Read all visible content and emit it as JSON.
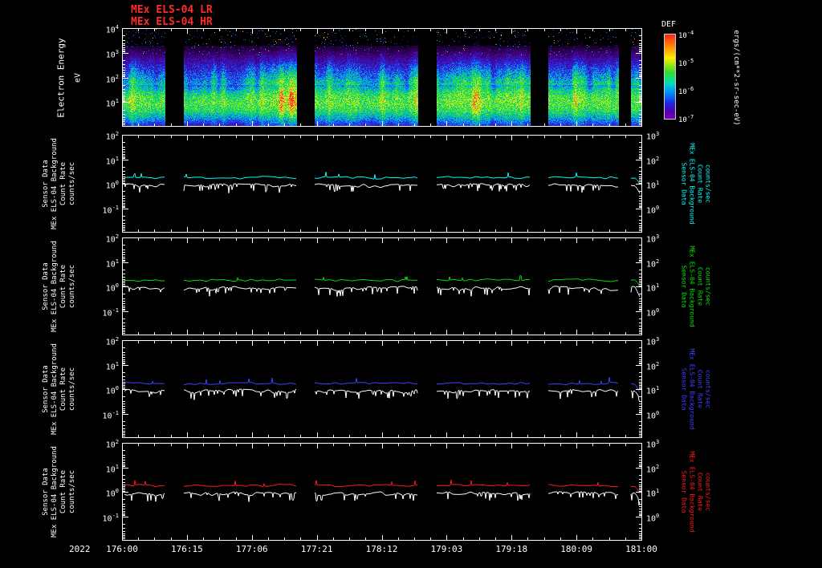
{
  "header": {
    "title_lr": "MEx ELS-04 LR",
    "title_hr": "MEx ELS-04 HR",
    "title_color": "#ff2a2a"
  },
  "x_axis": {
    "year": "2022",
    "tick_labels": [
      "176:00",
      "176:15",
      "177:06",
      "177:21",
      "178:12",
      "179:03",
      "179:18",
      "180:09",
      "181:00"
    ]
  },
  "spectrogram": {
    "ylabel_line1": "Electron Energy",
    "ylabel_line2": "eV",
    "y_ticks": [
      "10^4",
      "10^3",
      "10^2",
      "10^1"
    ],
    "colorbar": {
      "title": "DEF",
      "units": "ergs/(cm**2-sr-sec-eV)",
      "ticks": [
        "10^-4",
        "10^-5",
        "10^-6",
        "10^-7"
      ]
    }
  },
  "panels": [
    {
      "color": "#00ffff",
      "label_lines": [
        "Sensor Data",
        "MEx ELS-04 Background",
        "Count Rate",
        "counts/sec"
      ],
      "left_ticks": [
        "10^2",
        "10^1",
        "10^0",
        "10^-1"
      ],
      "right_ticks": [
        "10^3",
        "10^2",
        "10^1",
        "10^0"
      ]
    },
    {
      "color": "#00e000",
      "label_lines": [
        "Sensor Data",
        "MEx ELS-04 Background",
        "Count Rate",
        "counts/sec"
      ],
      "left_ticks": [
        "10^2",
        "10^1",
        "10^0",
        "10^-1"
      ],
      "right_ticks": [
        "10^3",
        "10^2",
        "10^1",
        "10^0"
      ]
    },
    {
      "color": "#4040ff",
      "label_lines": [
        "Sensor Data",
        "MEx ELS-04 Background",
        "Count Rate",
        "counts/sec"
      ],
      "left_ticks": [
        "10^2",
        "10^1",
        "10^0",
        "10^-1"
      ],
      "right_ticks": [
        "10^3",
        "10^2",
        "10^1",
        "10^0"
      ]
    },
    {
      "color": "#ff1a1a",
      "label_lines": [
        "Sensor Data",
        "MEx ELS-04 Background",
        "Count Rate",
        "counts/sec"
      ],
      "left_ticks": [
        "10^2",
        "10^1",
        "10^0",
        "10^-1"
      ],
      "right_ticks": [
        "10^3",
        "10^2",
        "10^1",
        "10^0"
      ]
    }
  ],
  "chart_data": [
    {
      "type": "heatmap",
      "title": "MEx ELS-04 LR/HR electron energy-time spectrogram",
      "xlabel": "time (day-of-year:hour, 2022)",
      "x_range": [
        "176:00",
        "181:00"
      ],
      "x_tick_labels": [
        "176:00",
        "176:15",
        "177:06",
        "177:21",
        "178:12",
        "179:03",
        "179:18",
        "180:09",
        "181:00"
      ],
      "ylabel": "Electron Energy (eV)",
      "y_log_range": [
        1,
        10000
      ],
      "y_tick_labels": [
        "10^4",
        "10^3",
        "10^2",
        "10^1"
      ],
      "value_label": "DEF ergs/(cm**2-sr-sec-eV)",
      "value_log_range": [
        1e-07,
        0.0001
      ],
      "colorscale": "rainbow (purple low to red high)",
      "legend_position": "right colorbar",
      "features": {
        "bright_band_eV": [
          3,
          150
        ],
        "hotspots": "quasi-periodic yellow/orange/red flares reaching ~300 eV",
        "diffuse_blue_purple_band_eV": [
          150,
          1500
        ],
        "sparse_speckle_above_eV": 1500,
        "data_gaps_frac": [
          [
            0.083,
            0.118
          ],
          [
            0.335,
            0.37
          ],
          [
            0.568,
            0.604
          ],
          [
            0.784,
            0.818
          ],
          [
            0.955,
            0.978
          ]
        ]
      }
    },
    {
      "type": "line",
      "title": "Sensor Data / MEx ELS-04 Background Count Rate (panel 1)",
      "ylabel": "Count Rate counts/sec",
      "ylim_log": [
        0.01,
        100
      ],
      "right_axis_log": [
        0.1,
        1000
      ],
      "x_range": [
        "176:00",
        "181:00"
      ],
      "series": [
        {
          "name": "MEx ELS-04 Background",
          "color": "#00ffff",
          "approx_mean": 1.8
        },
        {
          "name": "Sensor Data",
          "color": "#ffffff",
          "approx_mean": 0.85
        }
      ]
    },
    {
      "type": "line",
      "title": "Sensor Data / MEx ELS-04 Background Count Rate (panel 2)",
      "ylabel": "Count Rate counts/sec",
      "ylim_log": [
        0.01,
        100
      ],
      "right_axis_log": [
        0.1,
        1000
      ],
      "x_range": [
        "176:00",
        "181:00"
      ],
      "series": [
        {
          "name": "MEx ELS-04 Background",
          "color": "#00e000",
          "approx_mean": 1.8
        },
        {
          "name": "Sensor Data",
          "color": "#ffffff",
          "approx_mean": 0.85
        }
      ]
    },
    {
      "type": "line",
      "title": "Sensor Data / MEx ELS-04 Background Count Rate (panel 3)",
      "ylabel": "Count Rate counts/sec",
      "ylim_log": [
        0.01,
        100
      ],
      "right_axis_log": [
        0.1,
        1000
      ],
      "x_range": [
        "176:00",
        "181:00"
      ],
      "series": [
        {
          "name": "MEx ELS-04 Background",
          "color": "#4040ff",
          "approx_mean": 1.7
        },
        {
          "name": "Sensor Data",
          "color": "#ffffff",
          "approx_mean": 0.85
        }
      ]
    },
    {
      "type": "line",
      "title": "Sensor Data / MEx ELS-04 Background Count Rate (panel 4)",
      "ylabel": "Count Rate counts/sec",
      "ylim_log": [
        0.01,
        100
      ],
      "right_axis_log": [
        0.1,
        1000
      ],
      "x_range": [
        "176:00",
        "181:00"
      ],
      "series": [
        {
          "name": "MEx ELS-04 Background",
          "color": "#ff1a1a",
          "approx_mean": 1.8
        },
        {
          "name": "Sensor Data",
          "color": "#ffffff",
          "approx_mean": 0.85
        }
      ]
    }
  ]
}
